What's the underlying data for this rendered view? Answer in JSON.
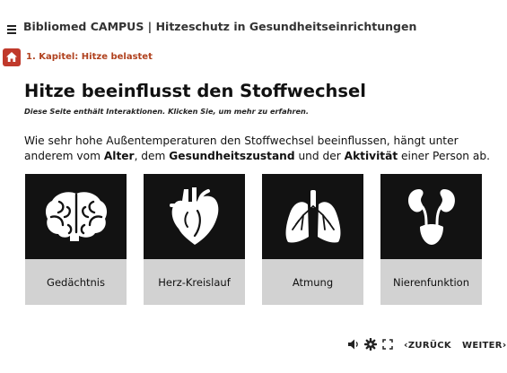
{
  "header": {
    "menu_icon": "hamburger-menu-icon",
    "title": "Bibliomed CAMPUS | Hitzeschutz in Gesundheitseinrichtungen"
  },
  "breadcrumb": {
    "home_icon": "home-icon",
    "label": "1. Kapitel: Hitze belastet"
  },
  "main": {
    "title": "Hitze beeinflusst den Stoffwechsel",
    "hint": "Diese Seite enthält Interaktionen. Klicken Sie, um mehr zu erfahren.",
    "intro": {
      "part1": "Wie sehr hohe Außentemperaturen den Stoffwechsel beeinflussen, hängt unter anderem vom ",
      "bold1": "Alter",
      "part2": ", dem ",
      "bold2": "Gesundheitszustand",
      "part3": " und der ",
      "bold3": "Aktivität",
      "part4": " einer Person ab."
    },
    "cards": [
      {
        "label": "Gedächtnis",
        "icon": "brain-icon"
      },
      {
        "label": "Herz-Kreislauf",
        "icon": "heart-icon"
      },
      {
        "label": "Atmung",
        "icon": "lungs-icon"
      },
      {
        "label": "Nierenfunktion",
        "icon": "kidneys-icon"
      }
    ]
  },
  "footer": {
    "controls": [
      "volume-icon",
      "settings-icon",
      "fullscreen-icon"
    ],
    "back_label": "ZURÜCK",
    "next_label": "WEITER"
  },
  "colors": {
    "accent": "#c0392b",
    "breadcrumb_text": "#b0411e",
    "card_image_bg": "#121212",
    "card_label_bg": "#d2d2d2"
  }
}
